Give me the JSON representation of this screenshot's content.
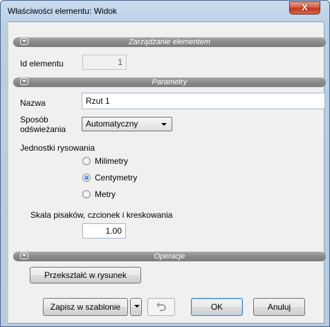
{
  "window": {
    "title": "Właściwości elementu: Widok",
    "close_glyph": "X"
  },
  "sections": {
    "management": "Zarządzanie elementem",
    "parameters": "Parametry",
    "operations": "Operacje"
  },
  "element": {
    "id_label": "Id elementu",
    "id_value": "1"
  },
  "params": {
    "name_label": "Nazwa",
    "name_value": "Rzut 1",
    "refresh_label_1": "Sposób",
    "refresh_label_2": "odświeżania",
    "refresh_selected": "Automatyczny",
    "units_label": "Jednostki rysowania",
    "units_options": [
      "Milimetry",
      "Centymetry",
      "Metry"
    ],
    "units_selected": "Centymetry",
    "scale_label": "Skala pisaków, czcionek i kreskowania",
    "scale_value": "1.00"
  },
  "operations": {
    "convert_label": "Przekształć w rysunek"
  },
  "footer": {
    "save_template_label": "Zapisz w szablonie",
    "ok_label": "OK",
    "cancel_label": "Anuluj",
    "undo_icon": "undo-arrow"
  }
}
